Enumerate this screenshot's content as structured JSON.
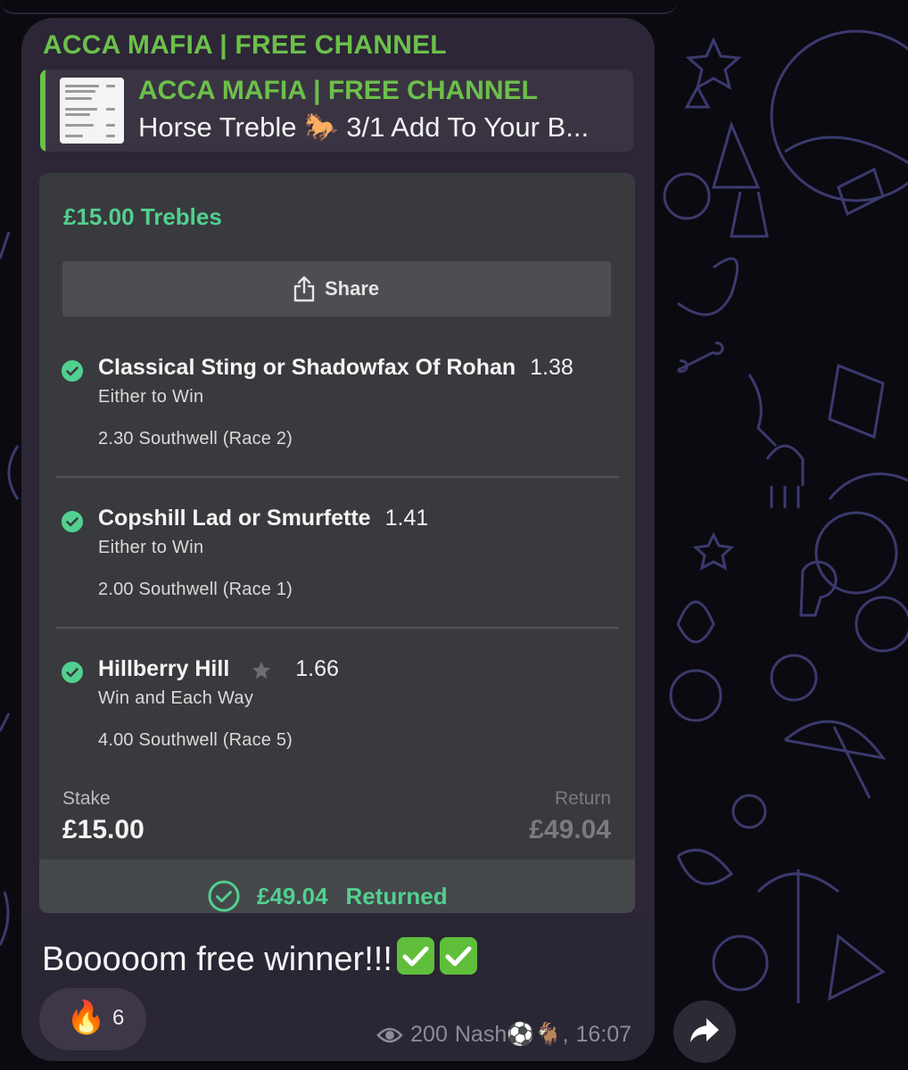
{
  "channel": {
    "name": "ACCA MAFIA | FREE CHANNEL"
  },
  "reply": {
    "title": "ACCA MAFIA | FREE CHANNEL",
    "text": "Horse Treble 🐎 3/1 Add To Your B..."
  },
  "bet": {
    "title": "£15.00 Trebles",
    "share_label": "Share",
    "selections": [
      {
        "name": "Classical Sting or Shadowfax Of Rohan",
        "odds": "1.38",
        "type": "Either to Win",
        "race": "2.30 Southwell (Race 2)"
      },
      {
        "name": "Copshill Lad or Smurfette",
        "odds": "1.41",
        "type": "Either to Win",
        "race": "2.00 Southwell (Race 1)"
      },
      {
        "name": "Hillberry Hill",
        "odds": "1.66",
        "type": "Win and Each Way",
        "race": "4.00 Southwell (Race 5)"
      }
    ],
    "stake_label": "Stake",
    "stake_value": "£15.00",
    "return_label": "Return",
    "return_value": "£49.04",
    "returned_amount": "£49.04",
    "returned_label": "Returned"
  },
  "message": {
    "text": "Booooom free winner!!!"
  },
  "reaction": {
    "emoji": "🔥",
    "count": "6"
  },
  "meta": {
    "views": "200",
    "author": "Nash⚽️🐐",
    "separator": ",",
    "time": "16:07"
  },
  "colors": {
    "channel_green": "#6cc04a",
    "bet_green": "#51d08f",
    "bubble_bg": "#2c2636",
    "card_bg": "#393a3d"
  },
  "icons": [
    "share-icon",
    "check-circle-icon",
    "star-icon",
    "returned-check-icon",
    "check-mark-emoji",
    "fire-emoji",
    "eye-icon",
    "forward-icon"
  ]
}
